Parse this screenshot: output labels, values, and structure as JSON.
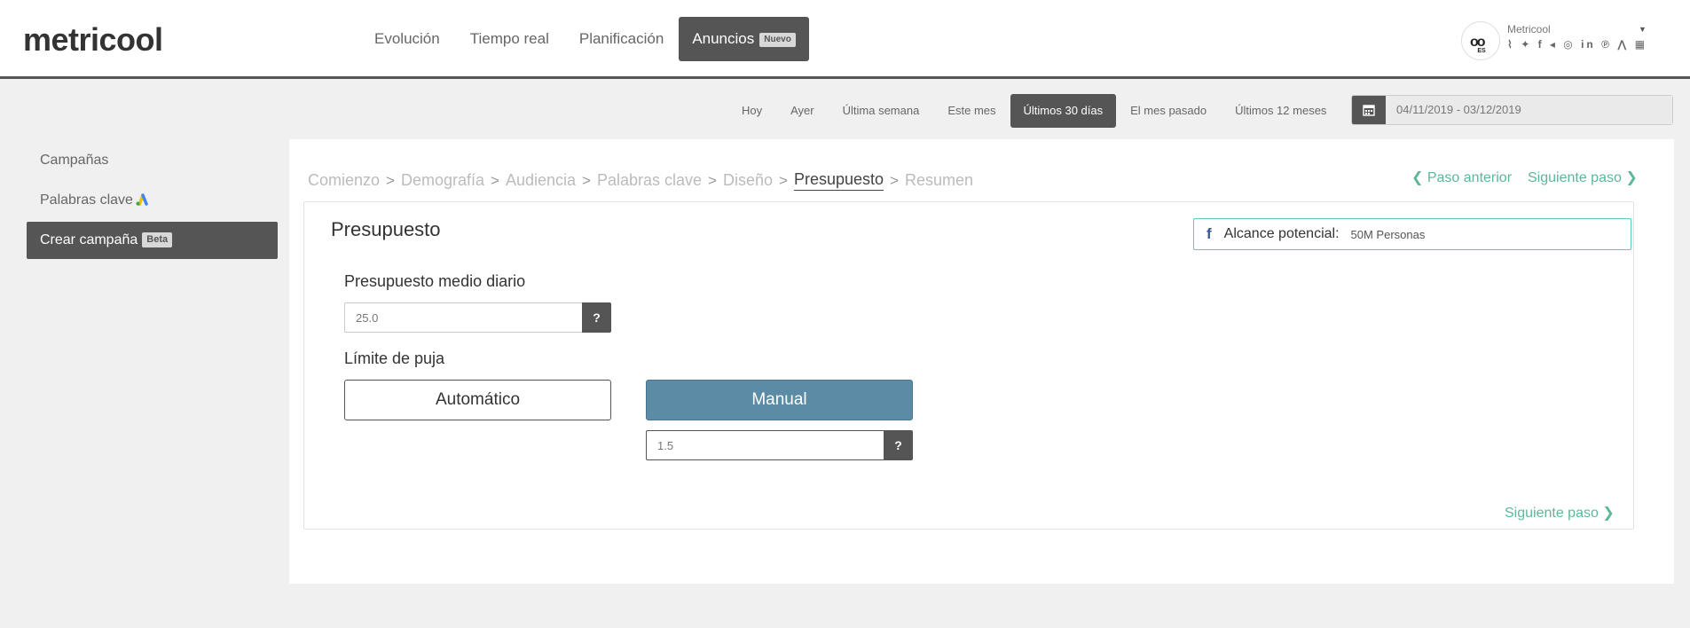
{
  "header": {
    "logo": "metricool",
    "nav": [
      "Evolución",
      "Tiempo real",
      "Planificación"
    ],
    "nav_active": "Anuncios",
    "nav_active_badge": "Nuevo"
  },
  "account": {
    "avatar_lang": "ES",
    "name": "Metricool",
    "social_icons": [
      "rss-icon",
      "twitter-icon",
      "facebook-icon",
      "megaphone-icon",
      "instagram-icon",
      "linkedin-icon",
      "pinterest-icon",
      "google-ads-icon",
      "store-icon"
    ],
    "social_glyphs": "⌇ ✦ f ◂ ◎ in ℗ ⋀ ▦"
  },
  "date_filter": {
    "options": [
      "Hoy",
      "Ayer",
      "Última semana",
      "Este mes",
      "Últimos 30 días",
      "El mes pasado",
      "Últimos 12 meses"
    ],
    "active_index": 4,
    "range": "04/11/2019 - 03/12/2019"
  },
  "sidebar": {
    "items": [
      {
        "label": "Campañas"
      },
      {
        "label": "Palabras clave"
      },
      {
        "label": "Crear campaña",
        "badge": "Beta"
      }
    ]
  },
  "wizard": {
    "steps": [
      "Comienzo",
      "Demografía",
      "Audiencia",
      "Palabras clave",
      "Diseño",
      "Presupuesto",
      "Resumen"
    ],
    "active_step": "Presupuesto",
    "prev_label": "Paso anterior",
    "next_label": "Siguiente paso"
  },
  "budget": {
    "title": "Presupuesto",
    "reach_label": "Alcance potencial:",
    "reach_value": "50M Personas",
    "daily_label": "Presupuesto medio diario",
    "daily_value": "25.0",
    "bid_label": "Límite de puja",
    "bid_auto": "Automático",
    "bid_manual": "Manual",
    "bid_value": "1.5",
    "help": "?",
    "next_label": "Siguiente paso"
  },
  "colors": {
    "dark": "#555555",
    "accent_green": "#5cb89a",
    "manual_blue": "#5c8ba6",
    "reach_border": "#5bc8c0"
  }
}
